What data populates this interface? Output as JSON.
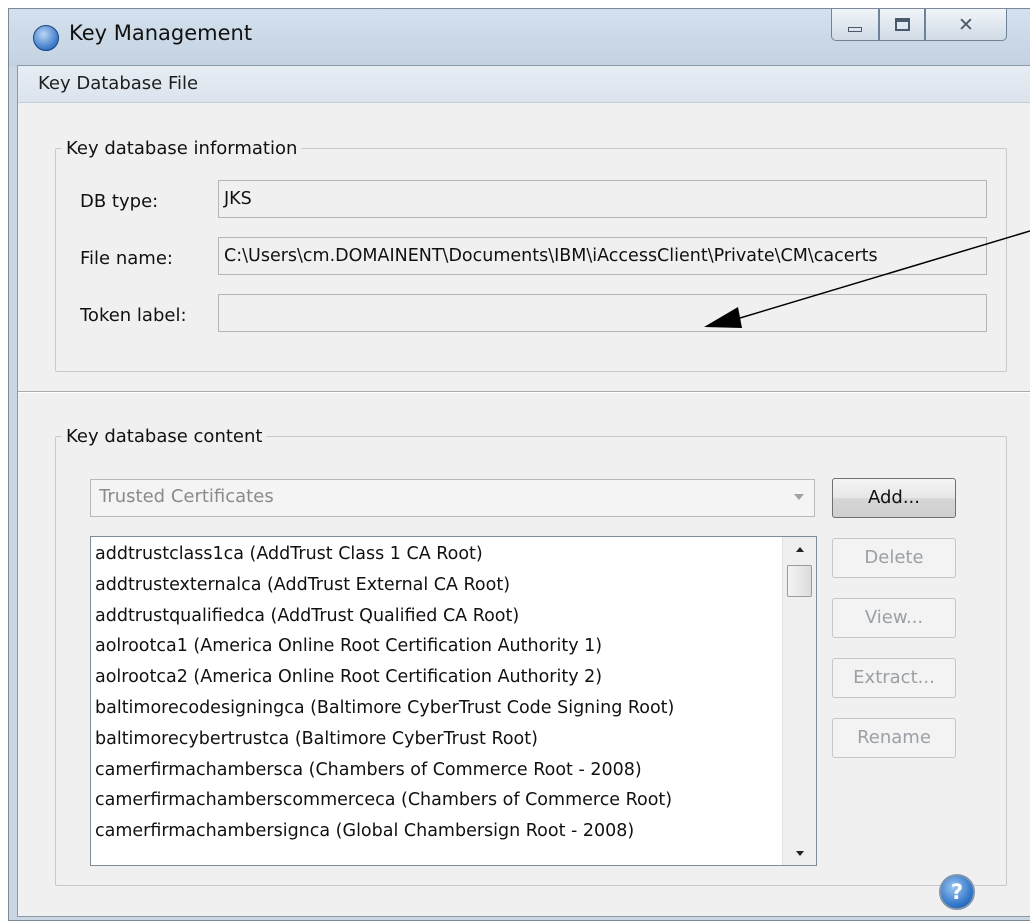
{
  "window": {
    "title": "Key Management",
    "close_glyph": "✕"
  },
  "menubar": {
    "label": "Key Database File"
  },
  "info_group": {
    "legend": "Key database information",
    "db_type_label": "DB type:",
    "db_type_value": "JKS",
    "file_name_label": "File name:",
    "file_name_value": "C:\\Users\\cm.DOMAINENT\\Documents\\IBM\\iAccessClient\\Private\\CM\\cacerts",
    "token_label": "Token label:",
    "token_value": ""
  },
  "content_group": {
    "legend": "Key database content",
    "combo_selected": "Trusted Certificates",
    "certificates": [
      "addtrustclass1ca (AddTrust Class 1 CA Root)",
      "addtrustexternalca (AddTrust External CA Root)",
      "addtrustqualifiedca (AddTrust Qualified CA Root)",
      "aolrootca1 (America Online Root Certification Authority 1)",
      "aolrootca2 (America Online Root Certification Authority 2)",
      "baltimorecodesigningca (Baltimore CyberTrust Code Signing Root)",
      "baltimorecybertrustca (Baltimore CyberTrust Root)",
      "camerfirmachambersca (Chambers of Commerce Root - 2008)",
      "camerfirmachamberscommerceca (Chambers of Commerce Root)",
      "camerfirmachambersignca (Global Chambersign Root - 2008)"
    ],
    "buttons": {
      "add": "Add...",
      "delete": "Delete",
      "view": "View...",
      "extract": "Extract...",
      "rename": "Rename"
    },
    "help_glyph": "?"
  },
  "icons": {
    "app": "key-management-app-icon",
    "minimize": "minimize-icon",
    "maximize": "maximize-icon",
    "close": "close-icon",
    "help": "help-icon",
    "annotation": "annotation-arrow"
  },
  "colors": {
    "title_bar": "#c9d6e3",
    "client_bg": "#f0f0f0",
    "disabled_text": "#9aa0a6"
  }
}
